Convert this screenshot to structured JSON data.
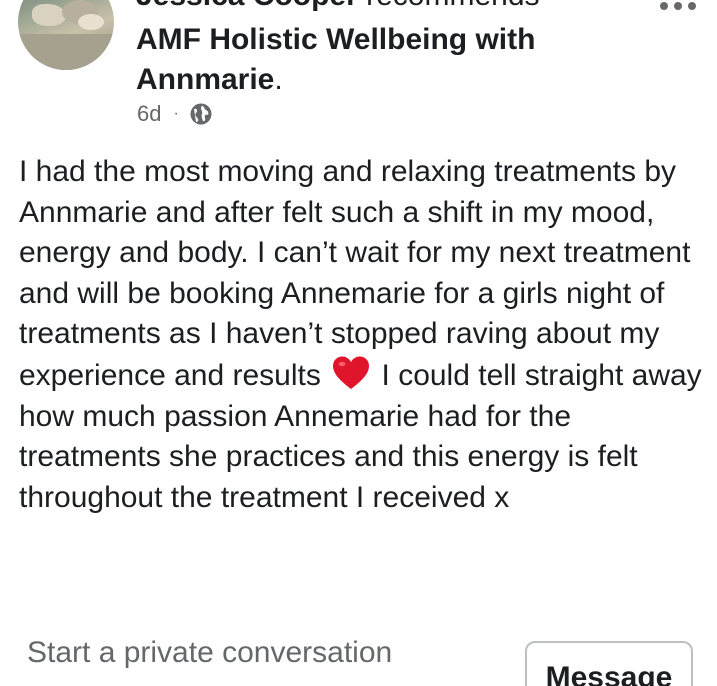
{
  "post": {
    "author": "Jessica Cooper",
    "action": " recommends",
    "page_name": "AMF Holistic Wellbeing with Annmarie",
    "page_name_suffix": ".",
    "time": "6d",
    "separator": "·",
    "privacy_icon": "globe-icon",
    "more_icon": "more-options-icon",
    "body_part1": "I had the most moving and relaxing treatments by Annmarie and after felt such a shift in my mood, energy and body. I can’t wait for my next treatment and will be booking Annemarie for a girls night of treatments as I haven’t stopped raving about my experience and results ",
    "emoji": "heart-emoji",
    "body_part2": " I could tell straight away how much passion Annemarie had for the treatments she practices and this energy is felt throughout the treatment I received x"
  },
  "footer": {
    "private_prompt": "Start a private conversation",
    "message_button": "Message"
  },
  "colors": {
    "text": "#1c1e21",
    "secondary": "#65676b",
    "heart": "#e0152b",
    "button_border": "#bcc0c4"
  }
}
